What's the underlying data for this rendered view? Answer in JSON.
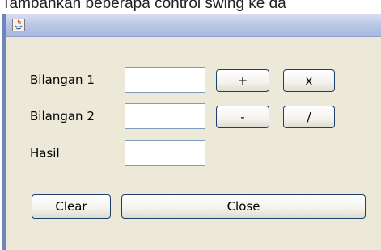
{
  "caption": "Tambahkan beberapa control swing ke da",
  "window": {
    "icon": "java-icon"
  },
  "labels": {
    "bilangan1": "Bilangan 1",
    "bilangan2": "Bilangan 2",
    "hasil": "Hasil"
  },
  "fields": {
    "bilangan1": "",
    "bilangan2": "",
    "hasil": ""
  },
  "buttons": {
    "plus": "+",
    "times": "x",
    "minus": "-",
    "divide": "/",
    "clear": "Clear",
    "close": "Close"
  }
}
